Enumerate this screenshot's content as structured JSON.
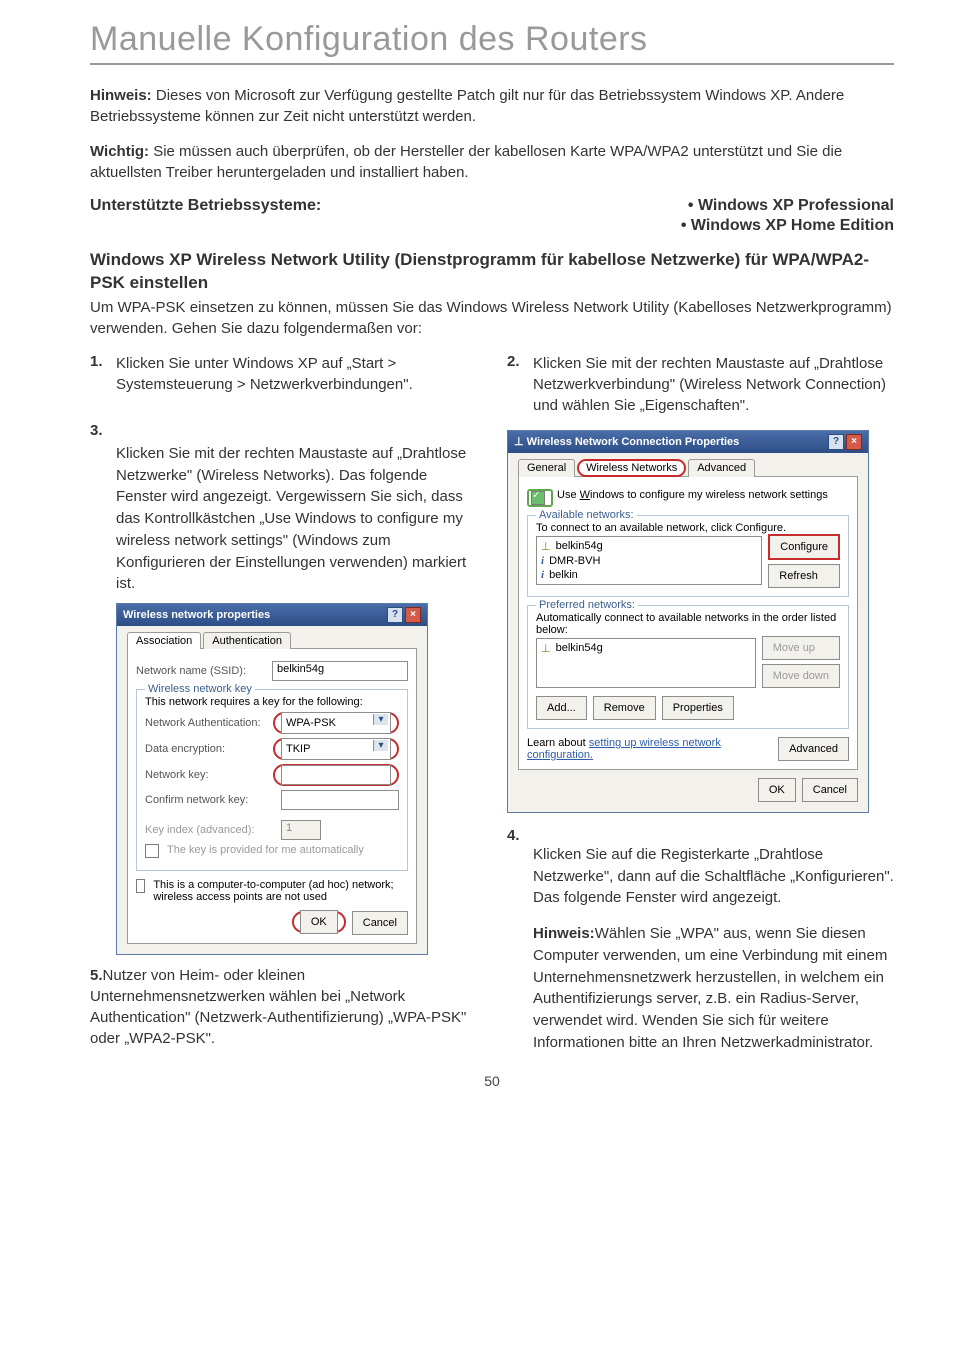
{
  "doc": {
    "title": "Manuelle Konfiguration des Routers",
    "p1_label": "Hinweis:",
    "p1": " Dieses von Microsoft zur Verfügung gestellte Patch gilt nur für das Betriebssystem Windows XP. Andere Betriebssysteme können zur Zeit nicht unterstützt werden.",
    "p2_label": "Wichtig:",
    "p2": " Sie müssen auch überprüfen, ob der Hersteller der kabellosen Karte WPA/WPA2 unterstützt und Sie die aktuellsten Treiber heruntergeladen und installiert haben.",
    "os_heading": "Unterstützte Betriebssysteme:",
    "os_items": [
      "•  Windows XP Professional",
      "• Windows XP Home Edition"
    ],
    "section_h": "Windows XP Wireless Network Utility (Dienstprogramm für kabellose Netzwerke) für WPA/WPA2-PSK einstellen",
    "section_p": "Um WPA-PSK einsetzen zu können, müssen Sie das Windows Wireless Network Utility (Kabelloses Netzwerkprogramm) verwenden. Gehen Sie dazu folgendermaßen vor:",
    "step1_num": "1.",
    "step1": "Klicken Sie unter Windows XP auf „Start > Systemsteuerung > Netzwerkverbindungen\".",
    "step2_num": "2.",
    "step2": "Klicken Sie mit der rechten Maustaste auf „Drahtlose Netzwerkverbindung\" (Wireless Network Connection) und wählen Sie „Eigenschaften\".",
    "step3_num": "3.",
    "step3": "Klicken Sie mit der rechten Maustaste auf „Drahtlose Netzwerke\" (Wireless Networks). Das folgende Fenster wird angezeigt. Vergewissern Sie sich, dass das Kontrollkästchen „Use Windows to configure my wireless network settings\" (Windows zum Konfigurieren der Einstellungen verwenden) markiert ist.",
    "step4_num": "4.",
    "step4": "Klicken Sie auf die Registerkarte „Drahtlose Netzwerke\", dann auf die Schaltfläche „Konfigurieren\". Das folgende Fenster wird angezeigt.",
    "step5_pre": "5.",
    "step5": "Nutzer von Heim- oder kleinen Unternehmensnetzwerken wählen bei „Network Authentication\" (Netzwerk-Authentifizierung)  „WPA-PSK\" oder „WPA2-PSK\".",
    "hint2_label": "Hinweis:",
    "hint2": "Wählen Sie „WPA\" aus, wenn Sie diesen Computer verwenden, um eine Verbindung mit einem Unternehmensnetzwerk herzustellen, in welchem ein Authentifizierungs server, z.B. ein Radius-Server, verwendet wird. Wenden Sie sich für weitere Informationen bitte an Ihren Netzwerkadministrator.",
    "pagenum": "50"
  },
  "dlg1": {
    "title": "Wireless network properties",
    "tab_assoc": "Association",
    "tab_auth": "Authentication",
    "lbl_ssid": "Network name (SSID):",
    "val_ssid": "belkin54g",
    "fs_key": "Wireless network key",
    "fs_key_note": "This network requires a key for the following:",
    "lbl_auth": "Network Authentication:",
    "val_auth": "WPA-PSK",
    "lbl_enc": "Data encryption:",
    "val_enc": "TKIP",
    "lbl_netkey": "Network key:",
    "lbl_confirm": "Confirm network key:",
    "lbl_keyidx": "Key index (advanced):",
    "val_keyidx": "1",
    "chk_auto": "The key is provided for me automatically",
    "chk_adhoc": "This is a computer-to-computer (ad hoc) network; wireless access points are not used",
    "btn_ok": "OK",
    "btn_cancel": "Cancel"
  },
  "dlg2": {
    "title": "Wireless Network Connection Properties",
    "tab_general": "General",
    "tab_wireless": "Wireless Networks",
    "tab_advanced": "Advanced",
    "chk_use": "Use Windows to configure my wireless network settings",
    "fs_avail": "Available networks:",
    "fs_avail_note": "To connect to an available network, click Configure.",
    "net1": "belkin54g",
    "net2": "DMR-BVH",
    "net3": "belkin",
    "btn_configure": "Configure",
    "btn_refresh": "Refresh",
    "fs_pref": "Preferred networks:",
    "fs_pref_note": "Automatically connect to available networks in the order listed below:",
    "pref1": "belkin54g",
    "btn_moveup": "Move up",
    "btn_movedown": "Move down",
    "btn_add": "Add...",
    "btn_remove": "Remove",
    "btn_props": "Properties",
    "link_learn": "setting up wireless network configuration.",
    "learn_pre": "Learn about ",
    "btn_advanced": "Advanced",
    "btn_ok": "OK",
    "btn_cancel": "Cancel"
  }
}
